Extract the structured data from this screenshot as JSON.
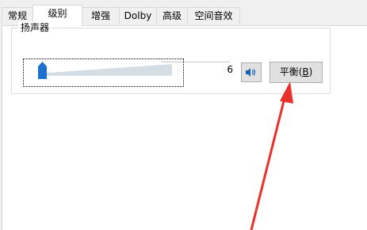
{
  "tabs": [
    {
      "label": "常规",
      "active": false
    },
    {
      "label": "级别",
      "active": true
    },
    {
      "label": "增强",
      "active": false
    },
    {
      "label": "Dolby",
      "active": false
    },
    {
      "label": "高级",
      "active": false
    },
    {
      "label": "空间音效",
      "active": false
    }
  ],
  "speaker": {
    "group_label": "扬声器",
    "volume_value": "6",
    "volume_level": 6,
    "volume_max": 100,
    "mute_icon": "speaker-icon",
    "balance_label": "平衡(",
    "balance_accel": "B",
    "balance_suffix": ")"
  },
  "colors": {
    "thumb": "#1e6fd0",
    "wedge": "#d4dde3",
    "arrow": "#e8312a",
    "speaker_icon": "#1a5fb4"
  }
}
